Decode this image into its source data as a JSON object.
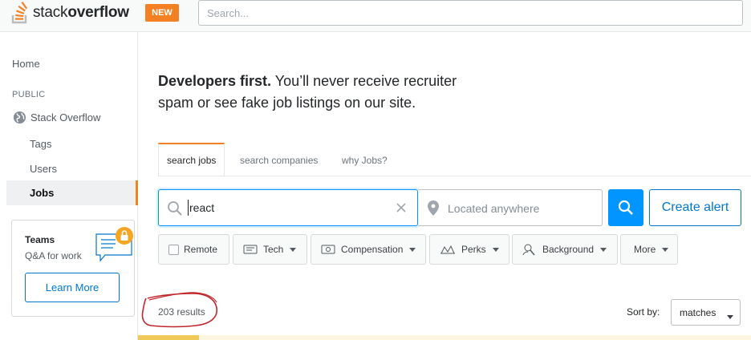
{
  "header": {
    "logo_light": "stack",
    "logo_bold": "overflow",
    "new_badge": "NEW",
    "search_placeholder": "Search..."
  },
  "sidebar": {
    "home": "Home",
    "section_public": "PUBLIC",
    "stack_overflow": "Stack Overflow",
    "items": [
      "Tags",
      "Users",
      "Jobs"
    ],
    "active_item": "Jobs",
    "teams": {
      "title": "Teams",
      "subtitle": "Q&A for work",
      "button": "Learn More"
    }
  },
  "main": {
    "headline_bold": "Developers first.",
    "headline_rest": " You’ll never receive recruiter spam or see fake job listings on our site.",
    "tabs": [
      "search jobs",
      "search companies",
      "why Jobs?"
    ],
    "active_tab": "search jobs",
    "search": {
      "value": "react",
      "location_placeholder": "Located anywhere",
      "create_alert": "Create alert"
    },
    "filters": [
      "Remote",
      "Tech",
      "Compensation",
      "Perks",
      "Background",
      "More"
    ],
    "results_count": "203 results",
    "sort_label": "Sort by:",
    "sort_value": "matches"
  },
  "colors": {
    "accent": "#f48024",
    "primary": "#0095ff",
    "link": "#0077cc",
    "annotation": "#c0272d"
  }
}
